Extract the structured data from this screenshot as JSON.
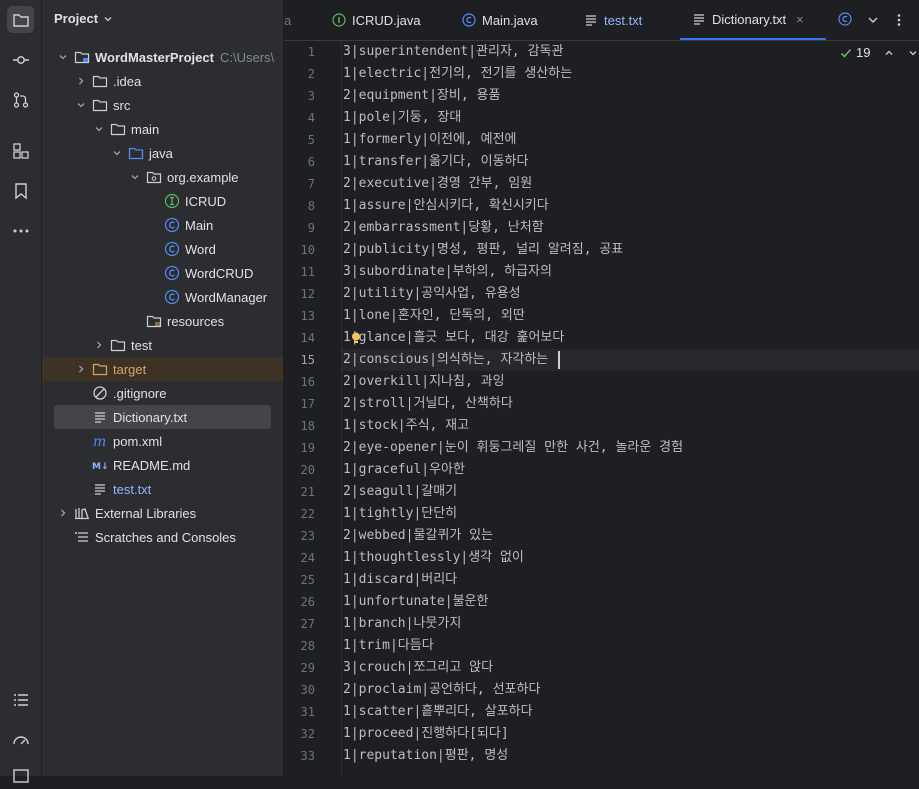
{
  "project_panel": {
    "title": "Project",
    "tree": [
      {
        "label": "WordMasterProject",
        "hint": "C:\\Users\\",
        "bold": true,
        "icon": "module-folder-icon"
      },
      {
        "label": ".idea",
        "icon": "folder-icon"
      },
      {
        "label": "src",
        "icon": "folder-icon"
      },
      {
        "label": "main",
        "icon": "folder-icon"
      },
      {
        "label": "java",
        "icon": "source-folder-icon"
      },
      {
        "label": "org.example",
        "icon": "package-icon"
      },
      {
        "label": "ICRUD",
        "icon": "interface-icon"
      },
      {
        "label": "Main",
        "icon": "class-icon"
      },
      {
        "label": "Word",
        "icon": "class-icon"
      },
      {
        "label": "WordCRUD",
        "icon": "class-icon"
      },
      {
        "label": "WordManager",
        "icon": "class-icon"
      },
      {
        "label": "resources",
        "icon": "resources-folder-icon"
      },
      {
        "label": "test",
        "icon": "folder-icon"
      },
      {
        "label": "target",
        "icon": "excluded-folder-icon"
      },
      {
        "label": ".gitignore",
        "icon": "ignore-file-icon"
      },
      {
        "label": "Dictionary.txt",
        "icon": "text-file-icon"
      },
      {
        "label": "pom.xml",
        "icon": "maven-icon"
      },
      {
        "label": "README.md",
        "icon": "markdown-icon"
      },
      {
        "label": "test.txt",
        "icon": "text-file-icon"
      },
      {
        "label": "External Libraries",
        "icon": "libraries-icon"
      },
      {
        "label": "Scratches and Consoles",
        "icon": "scratches-icon"
      }
    ]
  },
  "tabs": [
    {
      "label": "a",
      "icon": ""
    },
    {
      "label": "ICRUD.java",
      "icon": "interface-icon"
    },
    {
      "label": "Main.java",
      "icon": "class-icon"
    },
    {
      "label": "test.txt",
      "icon": "text-file-icon"
    },
    {
      "label": "Dictionary.txt",
      "icon": "text-file-icon",
      "close": "×"
    }
  ],
  "inspection_count": "19",
  "editor": {
    "current_line": 15,
    "lines": [
      "3|superintendent|관리자, 감독관",
      "1|electric|전기의, 전기를 생산하는",
      "2|equipment|장비, 용품",
      "1|pole|기둥, 장대",
      "1|formerly|이전에, 예전에",
      "1|transfer|옮기다, 이동하다",
      "2|executive|경영 간부, 임원",
      "1|assure|안심시키다, 확신시키다",
      "2|embarrassment|당황, 난처함",
      "2|publicity|명성, 평판, 널리 알려짐, 공표",
      "3|subordinate|부하의, 하급자의",
      "2|utility|공익사업, 유용성",
      "1|lone|혼자인, 단독의, 외딴",
      "1|glance|흘긋 보다, 대강 훑어보다",
      "2|conscious|의식하는, 자각하는",
      "2|overkill|지나침, 과잉",
      "2|stroll|거닐다, 산책하다",
      "1|stock|주식, 재고",
      "2|eye-opener|눈이 휘둥그레질 만한 사건, 놀라운 경험",
      "1|graceful|우아한",
      "2|seagull|갈매기",
      "1|tightly|단단히",
      "2|webbed|물갈퀴가 있는",
      "1|thoughtlessly|생각 없이",
      "1|discard|버리다",
      "1|unfortunate|불운한",
      "1|branch|나뭇가지",
      "1|trim|다듬다",
      "3|crouch|쪼그리고 앉다",
      "2|proclaim|공언하다, 선포하다",
      "1|scatter|흩뿌리다, 살포하다",
      "1|proceed|진행하다[되다]",
      "1|reputation|평판, 명성"
    ],
    "line_numbers": [
      "1",
      "2",
      "3",
      "4",
      "5",
      "6",
      "7",
      "8",
      "9",
      "10",
      "11",
      "12",
      "13",
      "14",
      "15",
      "16",
      "17",
      "18",
      "19",
      "20",
      "21",
      "22",
      "23",
      "24",
      "25",
      "26",
      "27",
      "28",
      "29",
      "30",
      "31",
      "32",
      "33"
    ]
  }
}
